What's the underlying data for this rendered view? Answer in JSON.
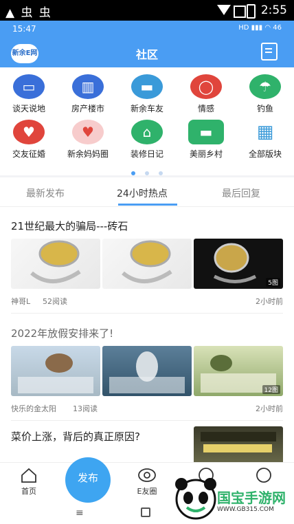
{
  "outer_status": {
    "left_glyphs": "▲ 虫 虫",
    "time": "2:55"
  },
  "inner_status": {
    "time": "15:47",
    "battery": "46"
  },
  "header": {
    "logo_text": "新余E网",
    "title": "社区"
  },
  "categories": [
    {
      "label": "谈天说地",
      "icon": "chat-icon",
      "color": "#3a6fd9"
    },
    {
      "label": "房产楼市",
      "icon": "building-icon",
      "color": "#3a6fd9"
    },
    {
      "label": "新余车友",
      "icon": "car-icon",
      "color": "#3a9ad9"
    },
    {
      "label": "情感",
      "icon": "heart-icon",
      "color": "#e0453c"
    },
    {
      "label": "钓鱼",
      "icon": "umbrella-icon",
      "color": "#2fb26b"
    },
    {
      "label": "交友征婚",
      "icon": "couple-icon",
      "color": "#e0453c"
    },
    {
      "label": "新余妈妈圈",
      "icon": "mother-icon",
      "color": "#f07b7b"
    },
    {
      "label": "装修日记",
      "icon": "house-icon",
      "color": "#2fb26b"
    },
    {
      "label": "美丽乡村",
      "icon": "bus-icon",
      "color": "#2fb26b"
    },
    {
      "label": "全部版块",
      "icon": "grid-icon",
      "color": "#3a9ad9"
    }
  ],
  "tabs": [
    {
      "label": "最新发布"
    },
    {
      "label": "24小时热点"
    },
    {
      "label": "最后回复"
    }
  ],
  "posts": [
    {
      "title": "21世纪最大的骗局---砖石",
      "author": "神哥L",
      "reads": "52阅读",
      "time": "2小时前",
      "image_count": "5图"
    },
    {
      "title": "2022年放假安排来了!",
      "author": "快乐的金太阳",
      "reads": "13阅读",
      "time": "2小时前",
      "image_count": "12图"
    },
    {
      "title": "菜价上涨，背后的真正原因?"
    }
  ],
  "bottom_nav": {
    "home": "首页",
    "publish": "发布",
    "efriends": "E友圈"
  },
  "watermark": {
    "brand": "国宝手游网",
    "url": "WWW.GB315.COM"
  }
}
